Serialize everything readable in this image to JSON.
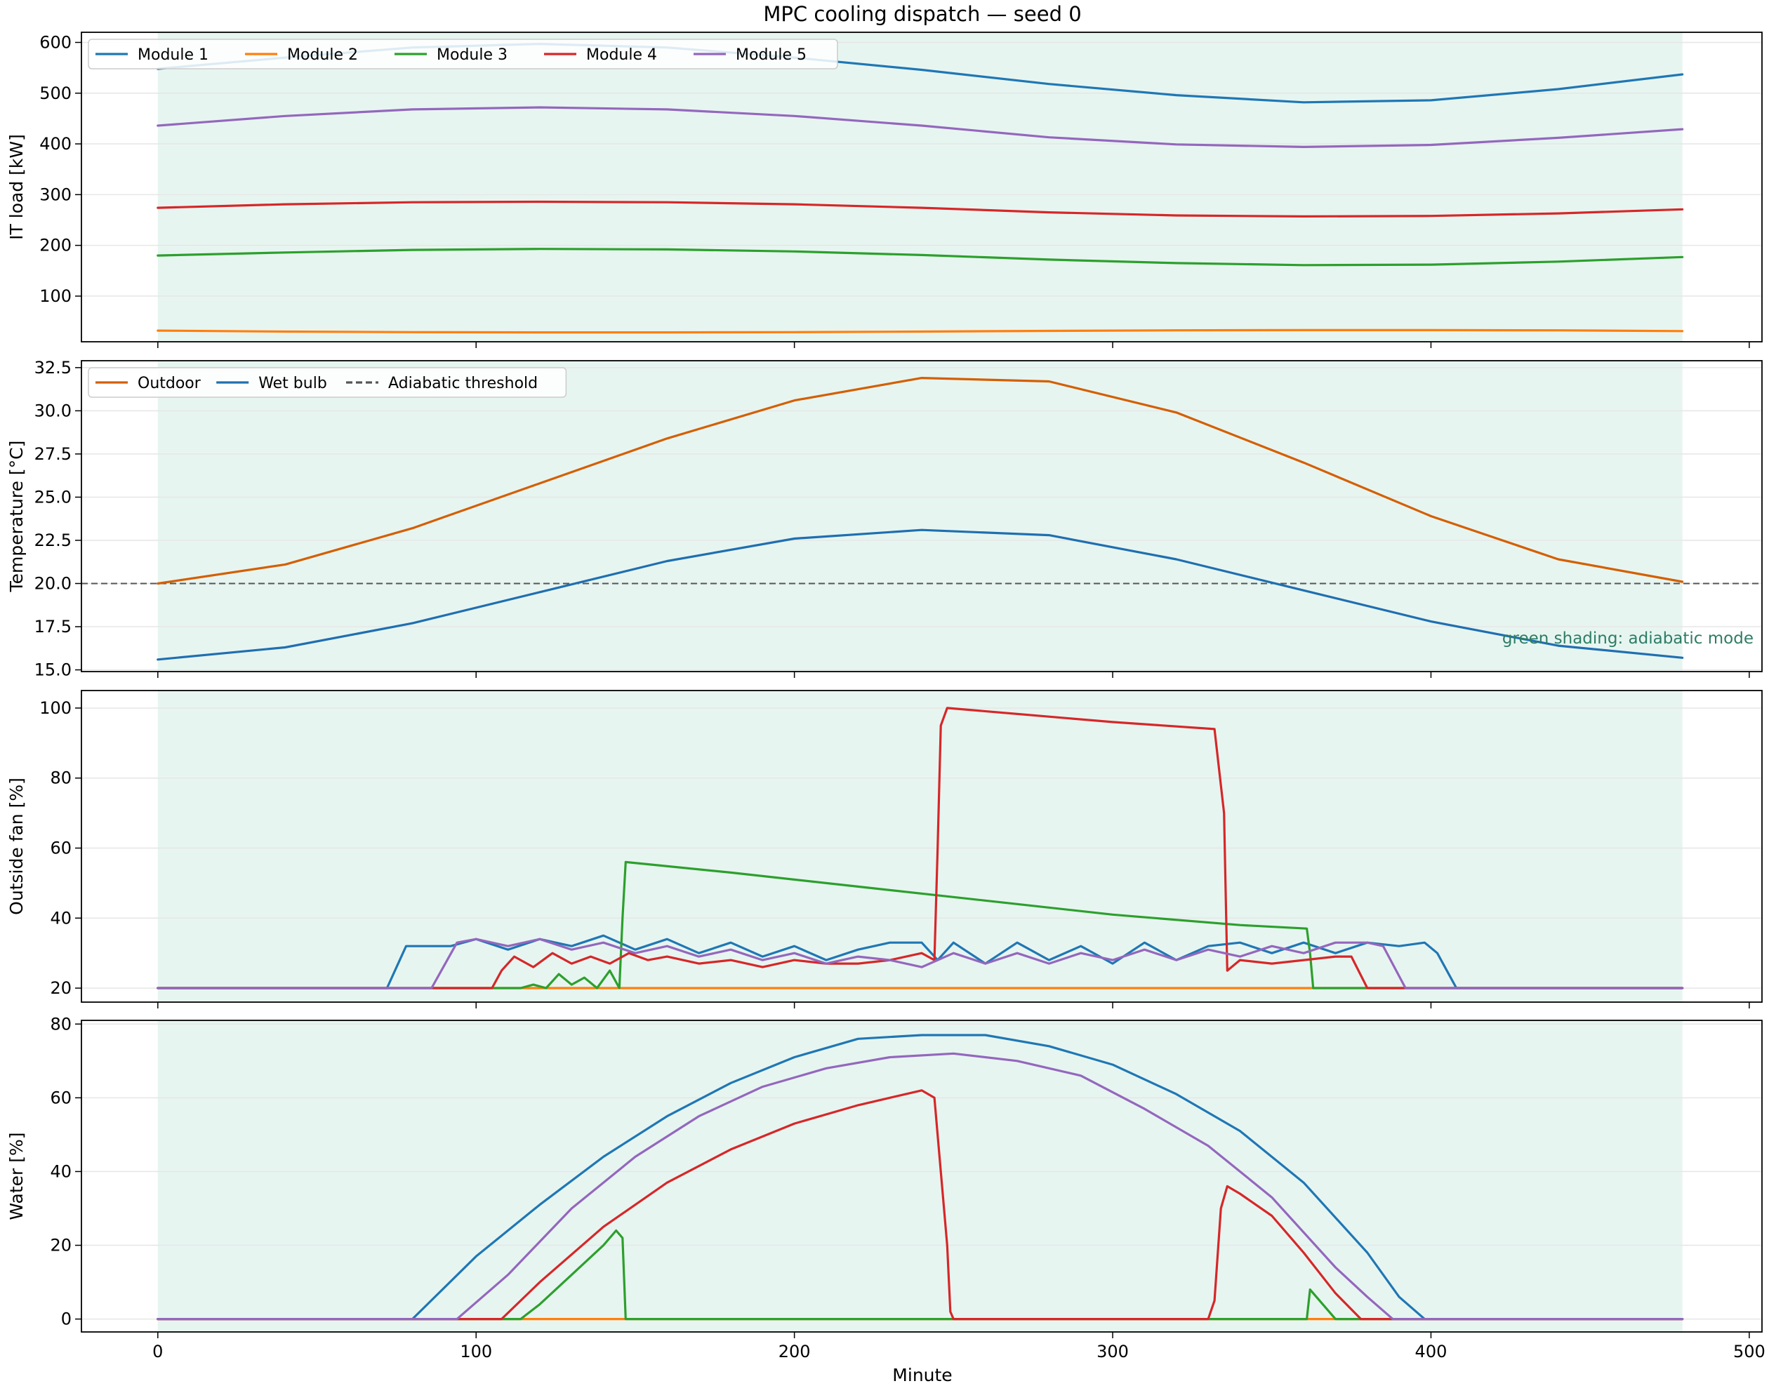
{
  "figure": {
    "title": "MPC cooling dispatch — seed 0",
    "xlabel": "Minute",
    "xlim": [
      -24,
      504
    ],
    "xticks": [
      0,
      100,
      200,
      300,
      400,
      500
    ],
    "shade_range": [
      0,
      479
    ],
    "note": "green shading: adiabatic mode"
  },
  "colors": {
    "module1": "#1f77b4",
    "module2": "#ff7f0e",
    "module3": "#2ca02c",
    "module4": "#d62728",
    "module5": "#9467bd",
    "outdoor": "#d45f00",
    "wetbulb": "#1f6fb0",
    "threshold": "#555555",
    "shade": "#e7f5f1",
    "note": "#2e7d64",
    "grid": "#e6e6e6"
  },
  "chart_data": [
    {
      "type": "line",
      "ylabel": "IT load [kW]",
      "ylim": [
        10,
        620
      ],
      "yticks": [
        100,
        200,
        300,
        400,
        500,
        600
      ],
      "grid": true,
      "legend": "top-left",
      "x": [
        0,
        40,
        80,
        120,
        160,
        200,
        240,
        280,
        320,
        360,
        400,
        440,
        479
      ],
      "series": [
        {
          "name": "Module 1",
          "color": "module1",
          "values": [
            548,
            570,
            590,
            597,
            590,
            570,
            546,
            518,
            496,
            482,
            486,
            508,
            537
          ]
        },
        {
          "name": "Module 2",
          "color": "module2",
          "values": [
            32,
            30,
            29,
            28.5,
            28.5,
            29,
            30,
            31.5,
            32.5,
            33,
            33,
            32.5,
            31
          ]
        },
        {
          "name": "Module 3",
          "color": "module3",
          "values": [
            180,
            186,
            191,
            193,
            192,
            188,
            181,
            172,
            165,
            161,
            162,
            168,
            177
          ]
        },
        {
          "name": "Module 4",
          "color": "module4",
          "values": [
            274,
            281,
            285,
            286,
            285,
            281,
            274,
            265,
            259,
            257,
            258,
            263,
            271
          ]
        },
        {
          "name": "Module 5",
          "color": "module5",
          "values": [
            436,
            455,
            468,
            472,
            468,
            455,
            436,
            413,
            399,
            394,
            398,
            412,
            429
          ]
        }
      ]
    },
    {
      "type": "line",
      "ylabel": "Temperature [°C]",
      "ylim": [
        14.9,
        32.9
      ],
      "yticks": [
        15.0,
        17.5,
        20.0,
        22.5,
        25.0,
        27.5,
        30.0,
        32.5
      ],
      "grid": true,
      "legend": "top-left",
      "threshold": {
        "name": "Adiabatic threshold",
        "value": 20.0,
        "color": "threshold"
      },
      "x": [
        0,
        40,
        80,
        120,
        160,
        200,
        240,
        280,
        320,
        360,
        400,
        440,
        479
      ],
      "series": [
        {
          "name": "Outdoor",
          "color": "outdoor",
          "values": [
            20.0,
            21.1,
            23.2,
            25.8,
            28.4,
            30.6,
            31.9,
            31.7,
            29.9,
            27.0,
            23.9,
            21.4,
            20.1
          ]
        },
        {
          "name": "Wet bulb",
          "color": "wetbulb",
          "values": [
            15.6,
            16.3,
            17.7,
            19.5,
            21.3,
            22.6,
            23.1,
            22.8,
            21.4,
            19.6,
            17.8,
            16.4,
            15.7
          ]
        }
      ]
    },
    {
      "type": "line",
      "ylabel": "Outside fan [%]",
      "ylim": [
        16,
        105
      ],
      "yticks": [
        20,
        40,
        60,
        80,
        100
      ],
      "grid": true,
      "series": [
        {
          "name": "Module 1",
          "color": "module1",
          "x": [
            0,
            72,
            78,
            92,
            100,
            110,
            120,
            130,
            140,
            150,
            160,
            170,
            180,
            190,
            200,
            210,
            220,
            230,
            240,
            245,
            250,
            260,
            270,
            280,
            290,
            300,
            310,
            320,
            330,
            340,
            350,
            360,
            370,
            380,
            390,
            398,
            402,
            408,
            479
          ],
          "values": [
            20,
            20,
            32,
            32,
            34,
            31,
            34,
            32,
            35,
            31,
            34,
            30,
            33,
            29,
            32,
            28,
            31,
            33,
            33,
            28,
            33,
            27,
            33,
            28,
            32,
            27,
            33,
            28,
            32,
            33,
            30,
            33,
            30,
            33,
            32,
            33,
            30,
            20,
            20
          ]
        },
        {
          "name": "Module 2",
          "color": "module2",
          "x": [
            0,
            479
          ],
          "values": [
            20,
            20
          ]
        },
        {
          "name": "Module 3",
          "color": "module3",
          "x": [
            0,
            114,
            118,
            122,
            126,
            130,
            134,
            138,
            142,
            145,
            146,
            147,
            180,
            220,
            260,
            300,
            340,
            361,
            362,
            363,
            370,
            479
          ],
          "values": [
            20,
            20,
            21,
            20,
            24,
            21,
            23,
            20,
            25,
            20,
            40,
            56,
            53,
            49,
            45,
            41,
            38,
            37,
            30,
            20,
            20,
            20
          ]
        },
        {
          "name": "Module 4",
          "color": "module4",
          "x": [
            0,
            86,
            105,
            108,
            112,
            118,
            124,
            130,
            136,
            142,
            148,
            154,
            160,
            170,
            180,
            190,
            200,
            210,
            220,
            230,
            240,
            244,
            245,
            246,
            248,
            300,
            332,
            335,
            336,
            340,
            350,
            360,
            370,
            375,
            380,
            385,
            390,
            479
          ],
          "values": [
            20,
            20,
            20,
            25,
            29,
            26,
            30,
            27,
            29,
            27,
            30,
            28,
            29,
            27,
            28,
            26,
            28,
            27,
            27,
            28,
            30,
            28,
            60,
            95,
            100,
            96,
            94,
            70,
            25,
            28,
            27,
            28,
            29,
            29,
            20,
            20,
            20,
            20
          ]
        },
        {
          "name": "Module 5",
          "color": "module5",
          "x": [
            0,
            86,
            94,
            100,
            110,
            120,
            130,
            140,
            150,
            160,
            170,
            180,
            190,
            200,
            210,
            220,
            230,
            240,
            250,
            260,
            270,
            280,
            290,
            300,
            310,
            320,
            330,
            340,
            350,
            360,
            370,
            380,
            385,
            392,
            479
          ],
          "values": [
            20,
            20,
            33,
            34,
            32,
            34,
            31,
            33,
            30,
            32,
            29,
            31,
            28,
            30,
            27,
            29,
            28,
            26,
            30,
            27,
            30,
            27,
            30,
            28,
            31,
            28,
            31,
            29,
            32,
            30,
            33,
            33,
            32,
            20,
            20
          ]
        }
      ]
    },
    {
      "type": "line",
      "ylabel": "Water [%]",
      "ylim": [
        -3.5,
        81
      ],
      "yticks": [
        0,
        20,
        40,
        60,
        80
      ],
      "grid": true,
      "series": [
        {
          "name": "Module 1",
          "color": "module1",
          "x": [
            0,
            80,
            100,
            120,
            140,
            160,
            180,
            200,
            220,
            240,
            260,
            280,
            300,
            320,
            340,
            360,
            380,
            390,
            398,
            479
          ],
          "values": [
            0,
            0,
            17,
            31,
            44,
            55,
            64,
            71,
            76,
            77,
            77,
            74,
            69,
            61,
            51,
            37,
            18,
            6,
            0,
            0
          ]
        },
        {
          "name": "Module 2",
          "color": "module2",
          "x": [
            0,
            479
          ],
          "values": [
            0,
            0
          ]
        },
        {
          "name": "Module 3",
          "color": "module3",
          "x": [
            0,
            114,
            120,
            130,
            140,
            144,
            146,
            147,
            361,
            362,
            366,
            370,
            479
          ],
          "values": [
            0,
            0,
            4,
            12,
            20,
            24,
            22,
            0,
            0,
            8,
            4,
            0,
            0
          ]
        },
        {
          "name": "Module 4",
          "color": "module4",
          "x": [
            0,
            108,
            120,
            140,
            160,
            180,
            200,
            220,
            230,
            240,
            244,
            248,
            249,
            250,
            330,
            332,
            334,
            336,
            340,
            350,
            360,
            370,
            378,
            479
          ],
          "values": [
            0,
            0,
            10,
            25,
            37,
            46,
            53,
            58,
            60,
            62,
            60,
            20,
            2,
            0,
            0,
            5,
            30,
            36,
            34,
            28,
            18,
            7,
            0,
            0
          ]
        },
        {
          "name": "Module 5",
          "color": "module5",
          "x": [
            0,
            94,
            110,
            130,
            150,
            170,
            190,
            210,
            230,
            250,
            270,
            290,
            310,
            330,
            350,
            370,
            380,
            388,
            479
          ],
          "values": [
            0,
            0,
            12,
            30,
            44,
            55,
            63,
            68,
            71,
            72,
            70,
            66,
            57,
            47,
            33,
            14,
            6,
            0,
            0
          ]
        }
      ]
    }
  ]
}
